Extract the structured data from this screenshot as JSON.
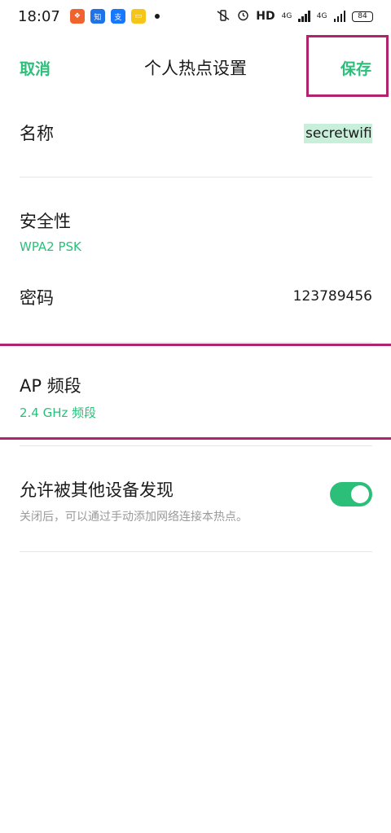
{
  "status_bar": {
    "time": "18:07",
    "hd": "HD",
    "net1": "4G",
    "net2": "4G",
    "battery": "84"
  },
  "header": {
    "cancel_label": "取消",
    "title": "个人热点设置",
    "save_label": "保存"
  },
  "fields": {
    "name_label": "名称",
    "name_value": "secretwifi",
    "security_label": "安全性",
    "security_value": "WPA2 PSK",
    "password_label": "密码",
    "password_value": "123789456",
    "ap_band_label": "AP 频段",
    "ap_band_value": "2.4 GHz 频段",
    "discover_label": "允许被其他设备发现",
    "discover_desc": "关闭后，可以通过手动添加网络连接本热点。"
  },
  "toggles": {
    "discoverable": true
  },
  "colors": {
    "accent": "#2bbf7a",
    "highlight": "#b0246e"
  }
}
